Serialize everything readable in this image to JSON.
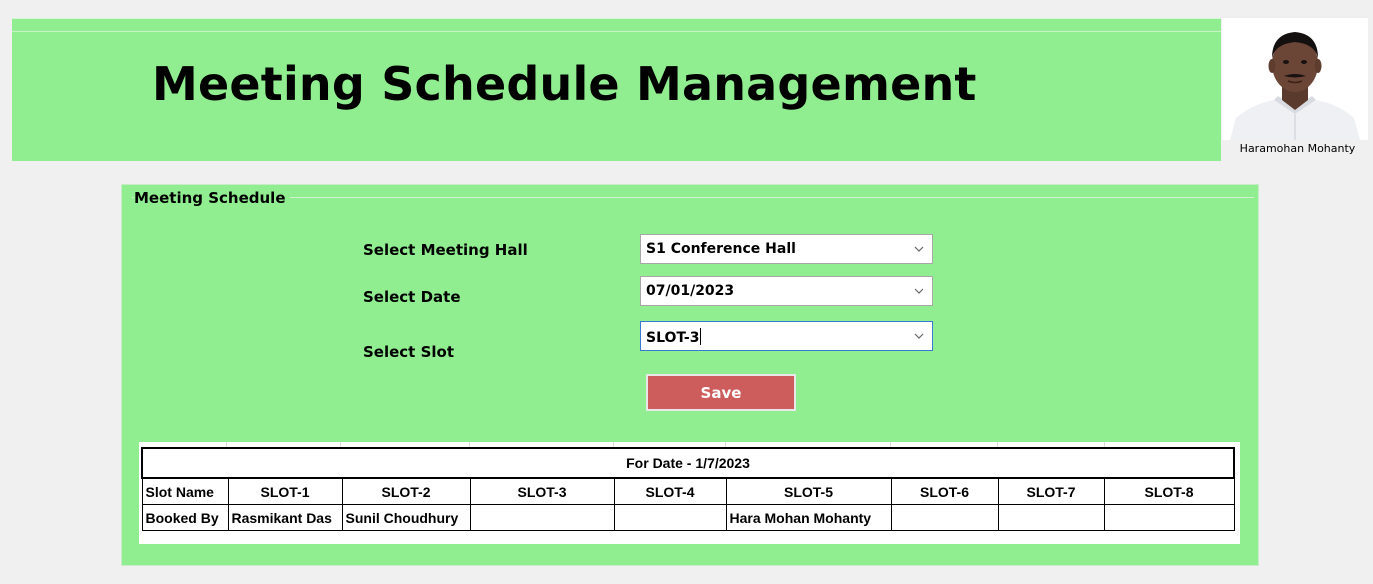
{
  "header": {
    "title": "Meeting Schedule Management",
    "user_name": "Haramohan Mohanty"
  },
  "panel": {
    "legend": "Meeting Schedule",
    "hall_label": "Select Meeting Hall",
    "hall_value": "S1 Conference Hall",
    "date_label": "Select Date",
    "date_value": "07/01/2023",
    "slot_label": "Select Slot",
    "slot_value": "SLOT-3",
    "save_label": "Save"
  },
  "schedule": {
    "title": "For Date - 1/7/2023",
    "row1_header": "Slot Name",
    "row2_header": "Booked By",
    "slots": [
      "SLOT-1",
      "SLOT-2",
      "SLOT-3",
      "SLOT-4",
      "SLOT-5",
      "SLOT-6",
      "SLOT-7",
      "SLOT-8"
    ],
    "booked_by": [
      "Rasmikant Das",
      "Sunil Choudhury",
      "",
      "",
      "Hara Mohan Mohanty",
      "",
      "",
      ""
    ]
  },
  "colors": {
    "banner_bg": "#90ee90",
    "save_button": "#cd5c5c",
    "page_bg": "#f0f0f0"
  },
  "icons": {
    "dropdown": "chevron-down-icon",
    "user_photo": "avatar"
  }
}
